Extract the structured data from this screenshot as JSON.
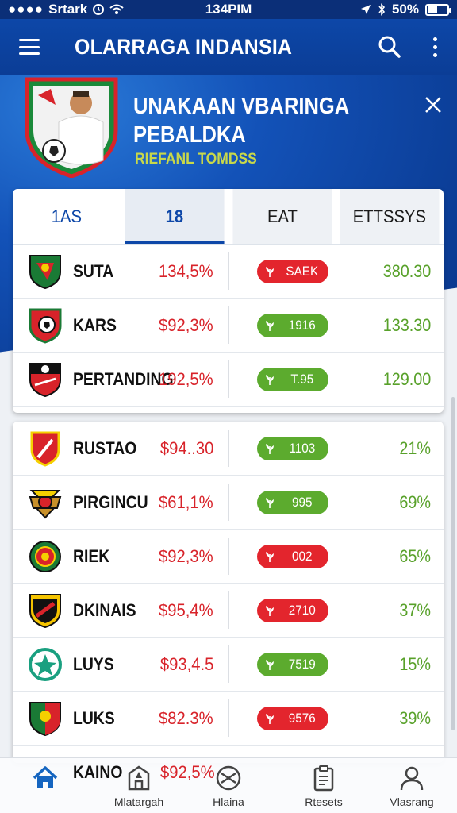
{
  "status": {
    "carrier": "Srtark",
    "time": "134PIM",
    "battery": "50%",
    "battery_level": 0.5
  },
  "appbar": {
    "title": "OLARRAGA INDANSIA"
  },
  "hero": {
    "title_line1": "UNAKAAN VBARINGA",
    "title_line2": "PEBALDKA",
    "subtitle": "RIEFANL TOMDSS"
  },
  "tabs": [
    {
      "label": "1AS"
    },
    {
      "label": "18"
    },
    {
      "label": "EAT"
    },
    {
      "label": "ETTSSYS"
    }
  ],
  "table1": [
    {
      "name": "SUTA",
      "pct": "134,5%",
      "pill": "SAEK",
      "pill_color": "red",
      "score": "380.30"
    },
    {
      "name": "KARS",
      "pct": "$92,3%",
      "pill": "1916",
      "pill_color": "green",
      "score": "133.30"
    },
    {
      "name": "PERTANDING",
      "pct": "192,5%",
      "pill": "T.95",
      "pill_color": "green",
      "score": "129.00"
    }
  ],
  "table2": [
    {
      "name": "RUSTAO",
      "pct": "$94..30",
      "pill": "1103",
      "pill_color": "green",
      "score": "21%"
    },
    {
      "name": "PIRGINCU",
      "pct": "$61,1%",
      "pill": "995",
      "pill_color": "green",
      "score": "69%"
    },
    {
      "name": "RIEK",
      "pct": "$92,3%",
      "pill": "002",
      "pill_color": "red",
      "score": "65%"
    },
    {
      "name": "DKINAIS",
      "pct": "$95,4%",
      "pill": "2710",
      "pill_color": "red",
      "score": "37%"
    },
    {
      "name": "LUYS",
      "pct": "$93,4.5",
      "pill": "7519",
      "pill_color": "green",
      "score": "15%"
    },
    {
      "name": "LUKS",
      "pct": "$82.3%",
      "pill": "9576",
      "pill_color": "red",
      "score": "39%"
    }
  ],
  "peek_row": {
    "name": "KAINO",
    "pct": "$92,5%"
  },
  "bottomnav": [
    {
      "label": "",
      "icon": "home-icon"
    },
    {
      "label": "Mlatargah",
      "icon": "stadium-icon"
    },
    {
      "label": "Hlaina",
      "icon": "match-icon"
    },
    {
      "label": "Rtesets",
      "icon": "clipboard-icon"
    },
    {
      "label": "Vlasrang",
      "icon": "profile-icon"
    }
  ],
  "colors": {
    "primary": "#0d47a8",
    "red": "#e3252d",
    "green": "#5cab2e",
    "score_green": "#58a12a",
    "pct_red": "#d8232a",
    "subtitle_yellow": "#c8d84a"
  }
}
